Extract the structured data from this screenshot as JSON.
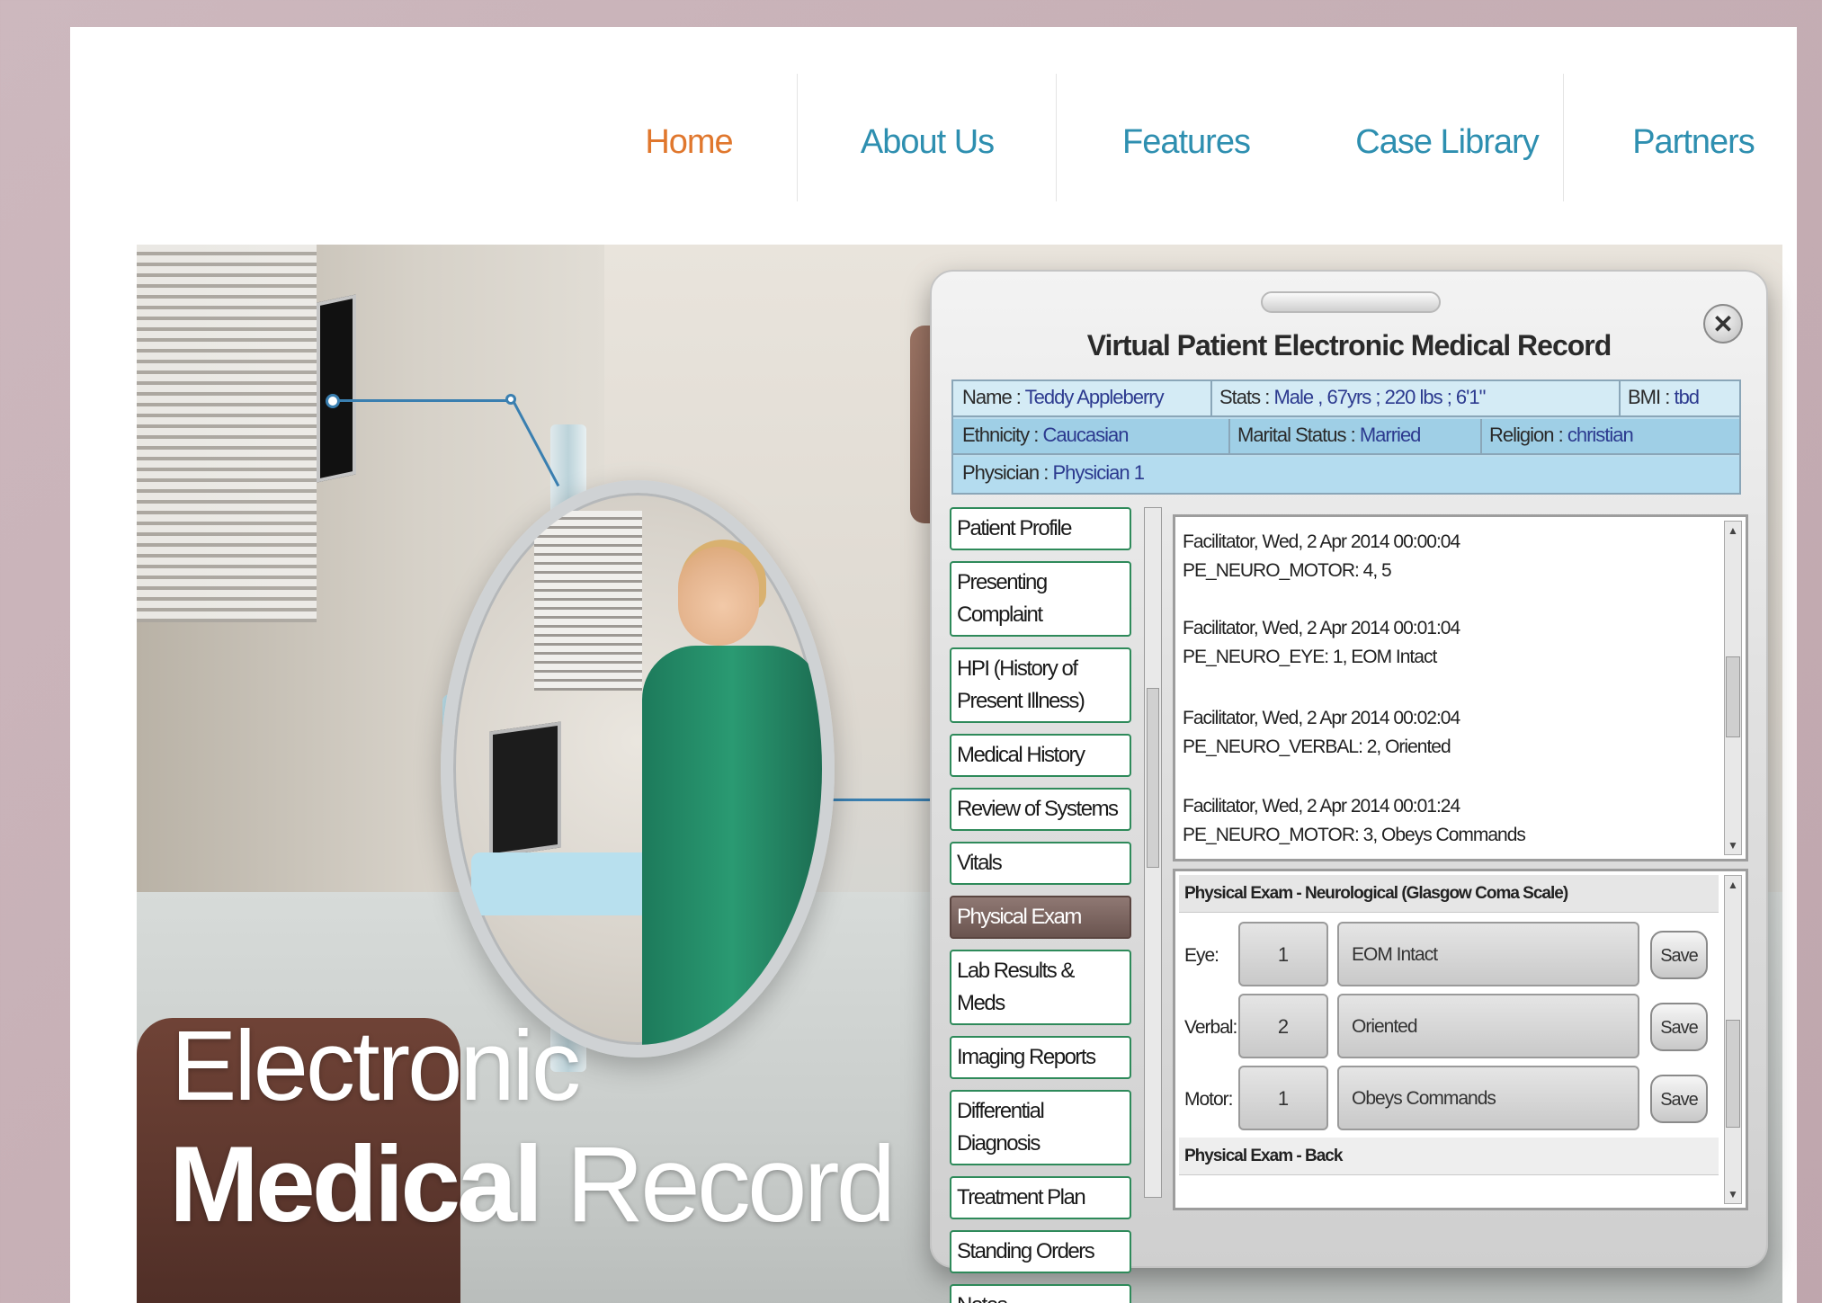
{
  "nav": {
    "items": [
      {
        "label": "Home",
        "active": true
      },
      {
        "label": "About Us",
        "active": false
      },
      {
        "label": "Features",
        "active": false
      },
      {
        "label": "Case Library",
        "active": false
      },
      {
        "label": "Partners",
        "active": false
      }
    ],
    "active_color": "#e0772d",
    "link_color": "#2e8fb0"
  },
  "hero": {
    "title_line1": "Electronic",
    "title_line2_bold": "Medical",
    "title_line2_rest": "Record"
  },
  "emr": {
    "title": "Virtual Patient Electronic Medical Record",
    "close_icon": "close-icon",
    "patient": {
      "name_label": "Name : ",
      "name": "Teddy Appleberry",
      "stats_label": "Stats : ",
      "stats": "Male , 67yrs ; 220 lbs ; 6'1\"",
      "bmi_label": "BMI : ",
      "bmi": "tbd",
      "ethnicity_label": "Ethnicity : ",
      "ethnicity": "Caucasian",
      "marital_label": "Marital Status : ",
      "marital": "Married",
      "religion_label": "Religion : ",
      "religion": "christian",
      "physician_label": "Physician : ",
      "physician": "Physician 1"
    },
    "menu": [
      {
        "label": "Patient Profile",
        "active": false
      },
      {
        "label": "Presenting Complaint",
        "active": false
      },
      {
        "label": "HPI (History of Present Illness)",
        "active": false
      },
      {
        "label": "Medical History",
        "active": false
      },
      {
        "label": "Review of Systems",
        "active": false
      },
      {
        "label": "Vitals",
        "active": false
      },
      {
        "label": "Physical Exam",
        "active": true
      },
      {
        "label": "Lab Results & Meds",
        "active": false
      },
      {
        "label": "Imaging Reports",
        "active": false
      },
      {
        "label": "Differential Diagnosis",
        "active": false
      },
      {
        "label": "Treatment Plan",
        "active": false
      },
      {
        "label": "Standing Orders",
        "active": false
      },
      {
        "label": "Notes",
        "active": false
      }
    ],
    "log": [
      {
        "line1": "Facilitator, Wed, 2 Apr 2014 00:00:04",
        "line2": "PE_NEURO_MOTOR: 4, 5"
      },
      {
        "line1": "Facilitator, Wed, 2 Apr 2014 00:01:04",
        "line2": "PE_NEURO_EYE: 1, EOM Intact"
      },
      {
        "line1": "Facilitator, Wed, 2 Apr 2014 00:02:04",
        "line2": "PE_NEURO_VERBAL: 2, Oriented"
      },
      {
        "line1": "Facilitator, Wed, 2 Apr 2014 00:01:24",
        "line2": "PE_NEURO_MOTOR: 3, Obeys Commands"
      }
    ],
    "exam": {
      "section_title": "Physical Exam - Neurological (Glasgow Coma Scale)",
      "rows": [
        {
          "label": "Eye:",
          "score": "1",
          "text": "EOM Intact",
          "save": "Save"
        },
        {
          "label": "Verbal:",
          "score": "2",
          "text": "Oriented",
          "save": "Save"
        },
        {
          "label": "Motor:",
          "score": "1",
          "text": "Obeys Commands",
          "save": "Save"
        }
      ],
      "next_section_title": "Physical Exam - Back"
    }
  }
}
